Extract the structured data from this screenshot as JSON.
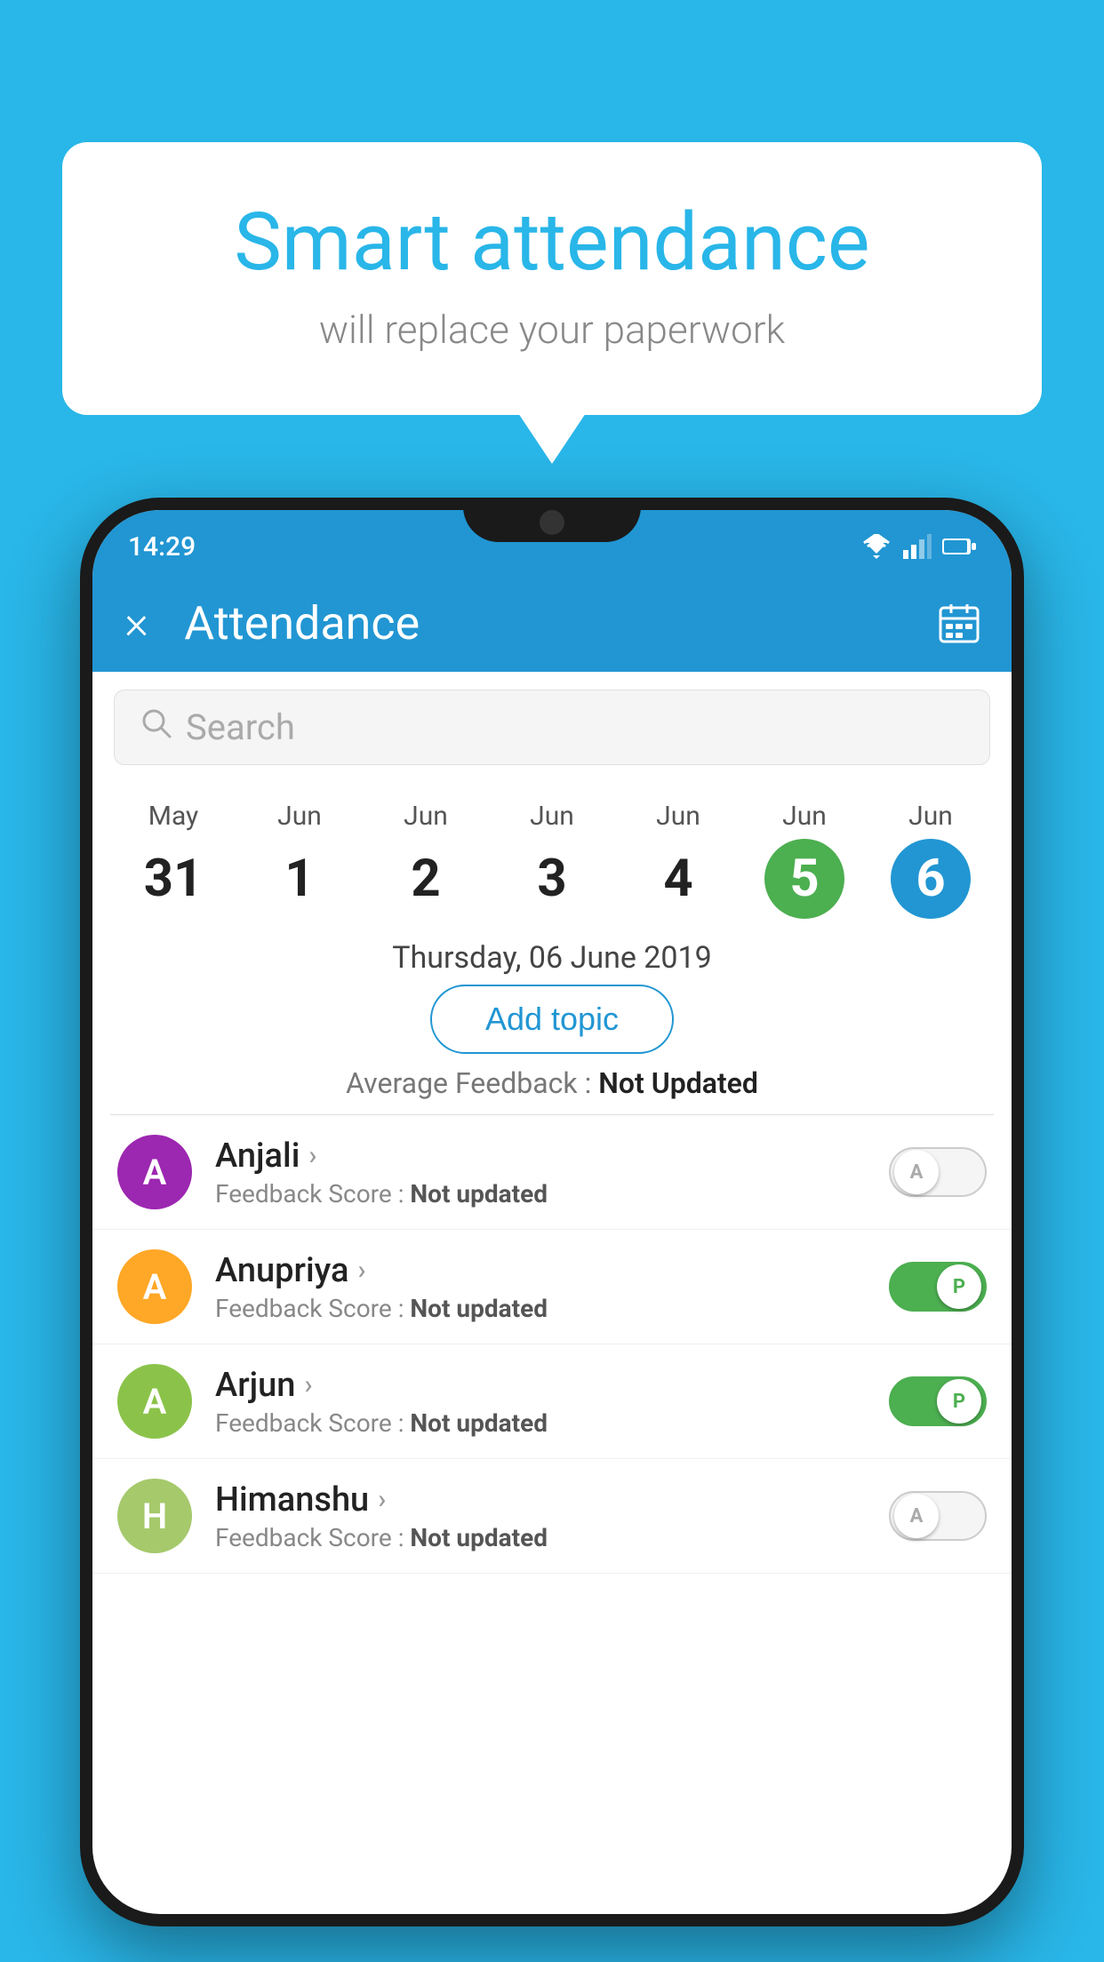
{
  "background_color": "#29b6e8",
  "speech_bubble": {
    "title": "Smart attendance",
    "subtitle": "will replace your paperwork"
  },
  "status_bar": {
    "time": "14:29"
  },
  "app_bar": {
    "title": "Attendance",
    "close_label": "×"
  },
  "search": {
    "placeholder": "Search"
  },
  "calendar": {
    "days": [
      {
        "month": "May",
        "date": "31",
        "state": "normal"
      },
      {
        "month": "Jun",
        "date": "1",
        "state": "normal"
      },
      {
        "month": "Jun",
        "date": "2",
        "state": "normal"
      },
      {
        "month": "Jun",
        "date": "3",
        "state": "normal"
      },
      {
        "month": "Jun",
        "date": "4",
        "state": "normal"
      },
      {
        "month": "Jun",
        "date": "5",
        "state": "today"
      },
      {
        "month": "Jun",
        "date": "6",
        "state": "selected"
      }
    ],
    "selected_date_label": "Thursday, 06 June 2019"
  },
  "add_topic_button": "Add topic",
  "avg_feedback_label": "Average Feedback :",
  "avg_feedback_value": "Not Updated",
  "students": [
    {
      "name": "Anjali",
      "initial": "A",
      "avatar_color": "#9c27b0",
      "feedback_label": "Feedback Score :",
      "feedback_value": "Not updated",
      "attendance": "absent",
      "toggle_label": "A"
    },
    {
      "name": "Anupriya",
      "initial": "A",
      "avatar_color": "#ffa726",
      "feedback_label": "Feedback Score :",
      "feedback_value": "Not updated",
      "attendance": "present",
      "toggle_label": "P"
    },
    {
      "name": "Arjun",
      "initial": "A",
      "avatar_color": "#8bc34a",
      "feedback_label": "Feedback Score :",
      "feedback_value": "Not updated",
      "attendance": "present",
      "toggle_label": "P"
    },
    {
      "name": "Himanshu",
      "initial": "H",
      "avatar_color": "#a5c96b",
      "feedback_label": "Feedback Score :",
      "feedback_value": "Not updated",
      "attendance": "absent",
      "toggle_label": "A"
    }
  ]
}
